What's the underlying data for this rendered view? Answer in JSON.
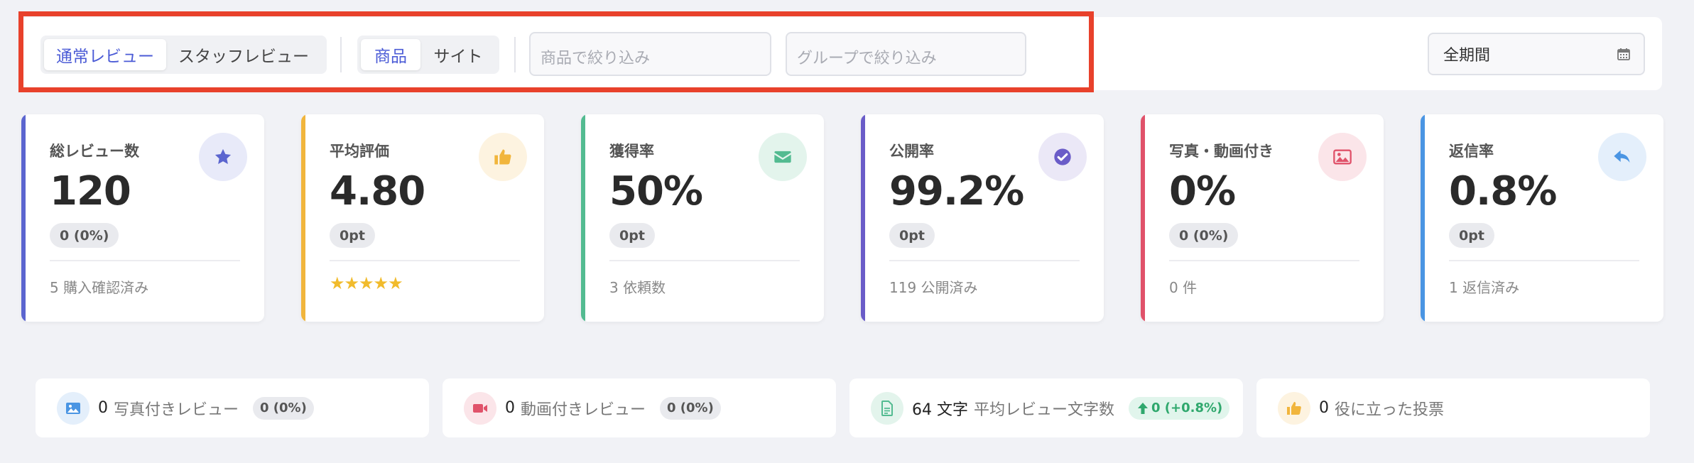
{
  "filters": {
    "review_type": [
      "通常レビュー",
      "スタッフレビュー"
    ],
    "review_type_active": 0,
    "target": [
      "商品",
      "サイト"
    ],
    "target_active": 0,
    "product_placeholder": "商品で絞り込み",
    "group_placeholder": "グループで絞り込み",
    "period": "全期間"
  },
  "stats": [
    {
      "title": "総レビュー数",
      "value": "120",
      "badge": "0 (0%)",
      "footer": "5 購入確認済み",
      "icon": "star-icon",
      "color": "#5b65cf",
      "bg": "#e8eaf9"
    },
    {
      "title": "平均評価",
      "value": "4.80",
      "badge": "0pt",
      "footer": "★★★★★",
      "icon": "thumbs-up-icon",
      "color": "#f1b53c",
      "bg": "#fdf3e0"
    },
    {
      "title": "獲得率",
      "value": "50%",
      "badge": "0pt",
      "footer": "3 依頼数",
      "icon": "envelope-icon",
      "color": "#53bb91",
      "bg": "#e3f4ec"
    },
    {
      "title": "公開率",
      "value": "99.2%",
      "badge": "0pt",
      "footer": "119 公開済み",
      "icon": "check-circle-icon",
      "color": "#6a5cc8",
      "bg": "#ebe8f7"
    },
    {
      "title": "写真・動画付き",
      "value": "0%",
      "badge": "0 (0%)",
      "footer": "0 件",
      "icon": "image-icon",
      "color": "#e0526a",
      "bg": "#fbe5e9"
    },
    {
      "title": "返信率",
      "value": "0.8%",
      "badge": "0pt",
      "footer": "1 返信済み",
      "icon": "reply-icon",
      "color": "#4a95e3",
      "bg": "#e4effb"
    }
  ],
  "summary": [
    {
      "value": "0",
      "label": "写真付きレビュー",
      "badge": "0 (0%)",
      "icon": "photo-icon",
      "color": "#4a95e3",
      "bg": "#e4effb"
    },
    {
      "value": "0",
      "label": "動画付きレビュー",
      "badge": "0 (0%)",
      "icon": "video-icon",
      "color": "#e0526a",
      "bg": "#fbe5e9"
    },
    {
      "value": "64 文字",
      "label": "平均レビュー文字数",
      "badge": "0 (+0.8%)",
      "icon": "document-icon",
      "color": "#53bb91",
      "bg": "#e3f4ec"
    },
    {
      "value": "0",
      "label": "役に立った投票",
      "badge": "",
      "icon": "thumbs-up-icon",
      "color": "#f1b53c",
      "bg": "#fdf3e0"
    }
  ]
}
